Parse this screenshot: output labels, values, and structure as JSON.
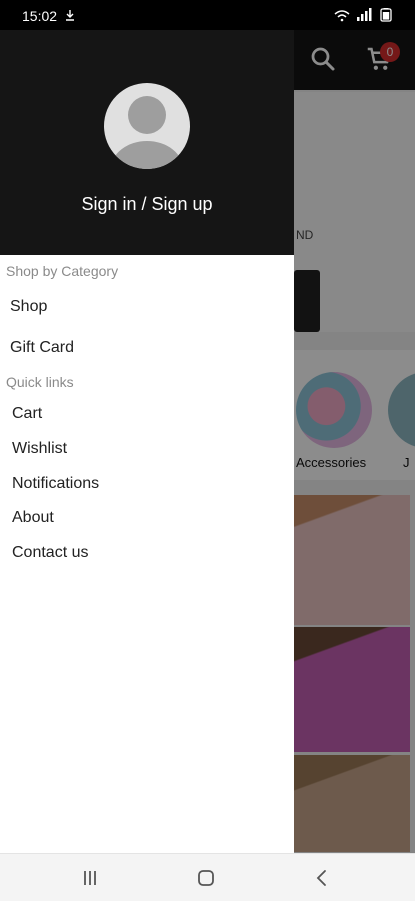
{
  "status_bar": {
    "time": "15:02",
    "download_icon": "download-icon",
    "icons": [
      "wifi-icon",
      "signal-icon",
      "battery-icon"
    ]
  },
  "background_app": {
    "cart_count": "0",
    "search_icon": "search-icon",
    "cart_icon": "cart-icon",
    "categories": [
      {
        "label": "Accessories"
      },
      {
        "label": "J"
      }
    ],
    "banner_text": "ND"
  },
  "drawer": {
    "header": {
      "avatar_icon": "account-avatar-icon",
      "sign_in_label": "Sign in / Sign up"
    },
    "shop_by_category": {
      "title": "Shop by Category",
      "items": [
        {
          "label": "Shop"
        },
        {
          "label": "Gift Card"
        }
      ]
    },
    "quick_links": {
      "title": "Quick links",
      "items": [
        {
          "label": "Cart"
        },
        {
          "label": "Wishlist"
        },
        {
          "label": "Notifications"
        },
        {
          "label": "About"
        },
        {
          "label": "Contact us"
        }
      ]
    }
  },
  "nav_bar": {
    "recent_icon": "recent-apps-icon",
    "home_icon": "home-icon",
    "back_icon": "back-icon"
  },
  "colors": {
    "drawer_header": "#151515",
    "badge": "#d52c2c",
    "section_label": "#8a8a8a"
  }
}
